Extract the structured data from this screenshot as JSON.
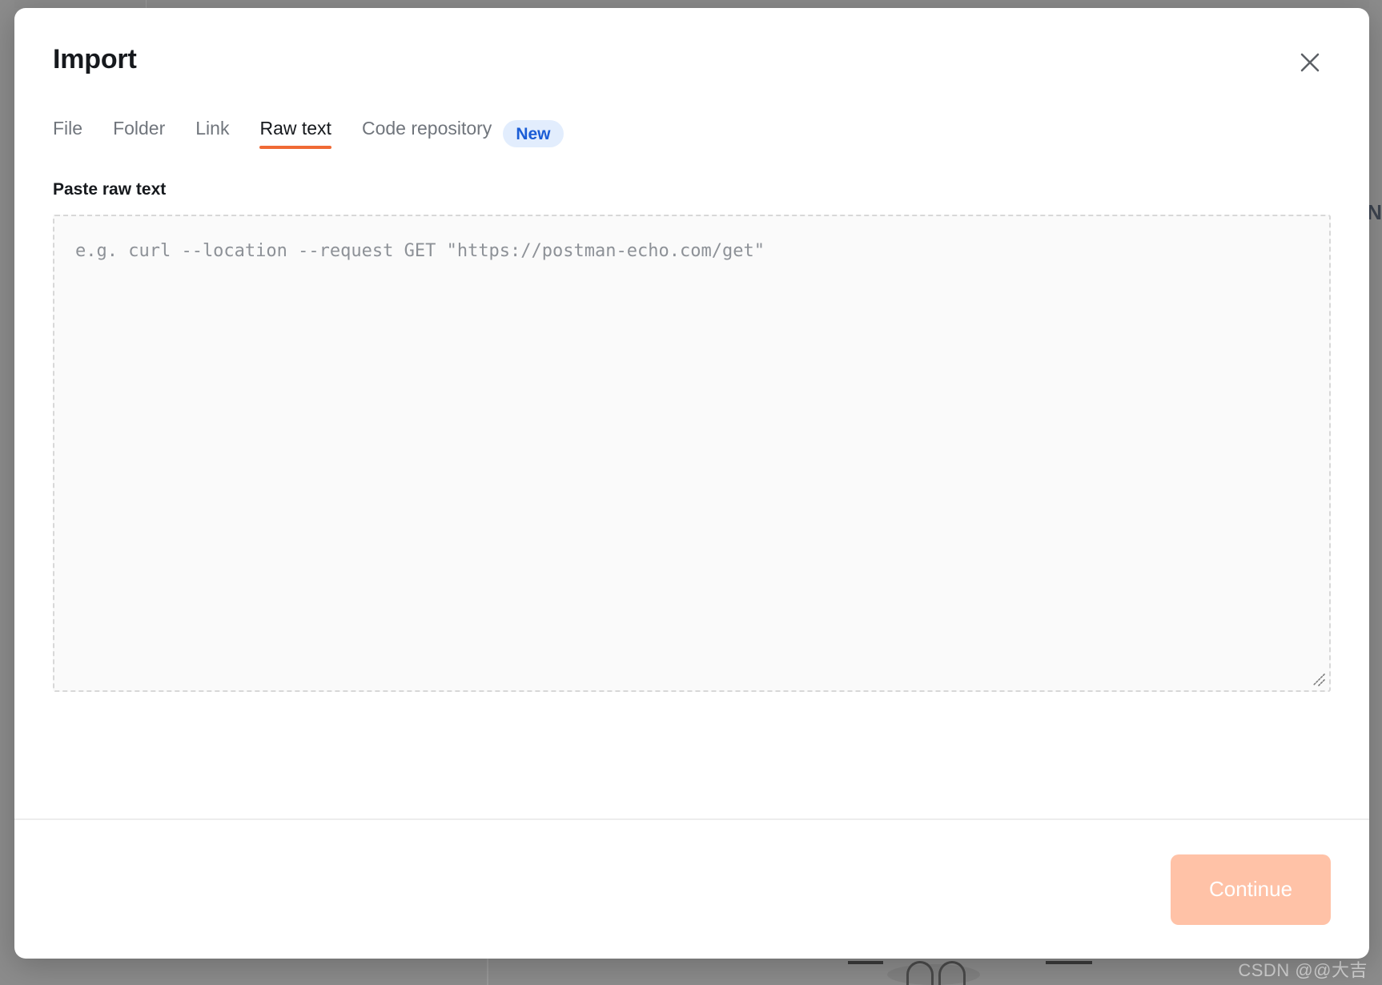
{
  "backdrop": {
    "watermark": "CSDN @@大吉",
    "edge_letter": "N"
  },
  "modal": {
    "title": "Import",
    "close_icon": "close-icon",
    "tabs": [
      {
        "label": "File",
        "active": false
      },
      {
        "label": "Folder",
        "active": false
      },
      {
        "label": "Link",
        "active": false
      },
      {
        "label": "Raw text",
        "active": true
      },
      {
        "label": "Code repository",
        "active": false
      }
    ],
    "badge": {
      "label": "New"
    },
    "section_label": "Paste raw text",
    "textarea": {
      "value": "",
      "placeholder": "e.g. curl --location --request GET \"https://postman-echo.com/get\""
    },
    "footer": {
      "continue_label": "Continue"
    }
  },
  "colors": {
    "accent_orange": "#f06a35",
    "continue_button_bg": "#ffc2a7",
    "badge_bg": "#e2edfd",
    "badge_text": "#1b5dd6",
    "backdrop": "#8c8c8c",
    "textarea_bg": "#fafafa",
    "textarea_border": "#d8d8d8"
  }
}
